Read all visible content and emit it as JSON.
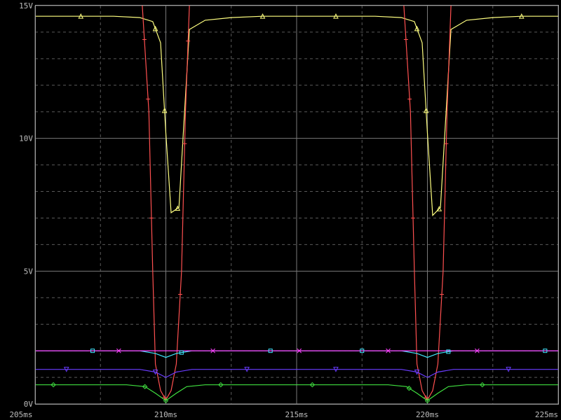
{
  "chart_data": {
    "type": "line",
    "title": "",
    "xlabel": "",
    "ylabel": "",
    "xlim": [
      205,
      225
    ],
    "ylim": [
      0,
      15
    ],
    "grid": true,
    "x_ticks": [
      {
        "value": 205,
        "label": "205ms"
      },
      {
        "value": 210,
        "label": "210ms"
      },
      {
        "value": 215,
        "label": "215ms"
      },
      {
        "value": 220,
        "label": "220ms"
      },
      {
        "value": 225,
        "label": "225ms"
      }
    ],
    "y_ticks": [
      {
        "value": 0,
        "label": "0V"
      },
      {
        "value": 5,
        "label": "5V"
      },
      {
        "value": 10,
        "label": "10V"
      },
      {
        "value": 15,
        "label": "15V"
      }
    ],
    "series": [
      {
        "color": "#ffff80",
        "marker": "triangle",
        "x": [
          205.0,
          206.0,
          206.75,
          208.0,
          209.0,
          209.5,
          209.8,
          210.0,
          210.2,
          210.5,
          210.9,
          211.5,
          212.5,
          213.7,
          215.0,
          216.0,
          217.0,
          218.0,
          219.0,
          219.5,
          219.8,
          220.0,
          220.2,
          220.5,
          220.9,
          221.5,
          222.5,
          223.6,
          225.0
        ],
        "y": [
          14.6,
          14.6,
          14.6,
          14.6,
          14.55,
          14.4,
          13.6,
          10.2,
          7.2,
          7.4,
          14.1,
          14.45,
          14.55,
          14.6,
          14.6,
          14.6,
          14.6,
          14.6,
          14.55,
          14.4,
          13.6,
          10.2,
          7.1,
          7.4,
          14.1,
          14.45,
          14.55,
          14.6,
          14.6
        ],
        "marker_x": [
          206.75,
          209.6,
          209.95,
          210.45,
          213.7,
          216.5,
          219.6,
          219.95,
          220.45,
          223.6
        ]
      },
      {
        "color": "#ff5050",
        "marker": "plus",
        "x": [
          209.1,
          209.35,
          209.5,
          209.6,
          209.8,
          210.0,
          210.2,
          210.4,
          210.6,
          210.75,
          210.9,
          219.1,
          219.35,
          219.5,
          219.6,
          219.8,
          220.0,
          220.2,
          220.4,
          220.6,
          220.75,
          220.9
        ],
        "y": [
          15.0,
          11.0,
          5.0,
          1.5,
          0.5,
          0.15,
          0.5,
          1.5,
          5.0,
          11.0,
          15.0,
          15.0,
          11.0,
          5.0,
          1.5,
          0.5,
          0.15,
          0.5,
          1.5,
          5.0,
          11.0,
          15.0
        ],
        "marker_x": [
          209.18,
          209.32,
          209.45,
          209.95,
          210.55,
          210.72,
          210.85,
          219.18,
          219.32,
          219.45,
          219.95,
          220.55,
          220.72
        ]
      },
      {
        "color": "#40e8ff",
        "marker": "square",
        "x": [
          205.0,
          209.0,
          209.6,
          210.0,
          210.4,
          211.0,
          215.0,
          219.0,
          219.6,
          220.0,
          220.4,
          221.0,
          225.0
        ],
        "y": [
          2.0,
          2.0,
          1.9,
          1.75,
          1.9,
          2.0,
          2.0,
          2.0,
          1.9,
          1.75,
          1.9,
          2.0,
          2.0
        ],
        "marker_x": [
          207.2,
          210.6,
          214.0,
          217.5,
          220.8,
          224.5
        ]
      },
      {
        "color": "#ff40ff",
        "marker": "x",
        "x": [
          205.0,
          225.0
        ],
        "y": [
          2.0,
          2.0
        ],
        "marker_x": [
          208.2,
          211.8,
          215.1,
          218.5,
          221.9
        ]
      },
      {
        "color": "#6a3cff",
        "marker": "triangle-down",
        "x": [
          205.0,
          209.0,
          209.6,
          210.0,
          210.4,
          211.0,
          215.0,
          219.0,
          219.6,
          220.0,
          220.4,
          221.0,
          225.0
        ],
        "y": [
          1.3,
          1.3,
          1.2,
          1.0,
          1.2,
          1.3,
          1.3,
          1.3,
          1.2,
          1.0,
          1.2,
          1.3,
          1.3
        ],
        "marker_x": [
          206.2,
          209.6,
          213.1,
          216.5,
          219.6,
          223.1
        ]
      },
      {
        "color": "#40e040",
        "marker": "diamond",
        "x": [
          205.0,
          208.5,
          209.2,
          209.6,
          210.0,
          210.4,
          210.8,
          211.5,
          215.0,
          218.5,
          219.2,
          219.6,
          220.0,
          220.4,
          220.8,
          221.5,
          225.0
        ],
        "y": [
          0.72,
          0.72,
          0.65,
          0.4,
          0.12,
          0.4,
          0.65,
          0.72,
          0.72,
          0.72,
          0.65,
          0.4,
          0.12,
          0.4,
          0.65,
          0.72,
          0.72
        ],
        "marker_x": [
          205.7,
          209.2,
          210.0,
          212.1,
          215.6,
          219.3,
          220.0,
          222.1
        ]
      }
    ]
  }
}
